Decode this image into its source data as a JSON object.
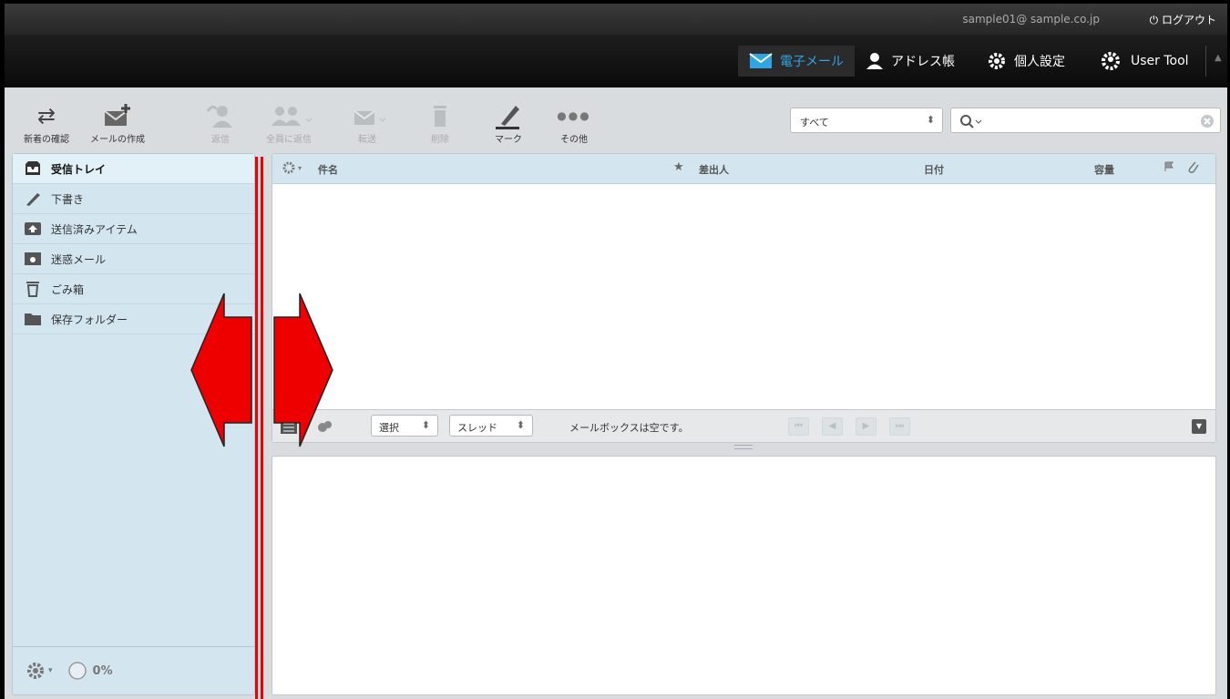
{
  "header": {
    "user_email": "sample01@ sample.co.jp",
    "logout_label": "ログアウト"
  },
  "nav": {
    "items": [
      {
        "label": "電子メール",
        "icon": "envelope-icon",
        "active": true
      },
      {
        "label": "アドレス帳",
        "icon": "person-icon"
      },
      {
        "label": "個人設定",
        "icon": "gear-icon"
      },
      {
        "label": "User Tool",
        "icon": "user-gear-icon"
      }
    ]
  },
  "toolbar": {
    "buttons": [
      {
        "label": "新着の確認",
        "icon": "refresh-arrows-icon",
        "enabled": true
      },
      {
        "label": "メールの作成",
        "icon": "compose-icon",
        "enabled": true
      },
      {
        "label": "返信",
        "icon": "reply-icon",
        "enabled": false
      },
      {
        "label": "全員に返信",
        "icon": "reply-all-icon",
        "enabled": false
      },
      {
        "label": "転送",
        "icon": "forward-icon",
        "enabled": false
      },
      {
        "label": "削除",
        "icon": "trash-icon",
        "enabled": false
      },
      {
        "label": "マーク",
        "icon": "pen-icon",
        "enabled": true
      },
      {
        "label": "その他",
        "icon": "more-dots-icon",
        "enabled": true
      }
    ],
    "filter_value": "すべて"
  },
  "sidebar": {
    "folders": [
      {
        "label": "受信トレイ",
        "icon": "inbox-icon",
        "active": true
      },
      {
        "label": "下書き",
        "icon": "pencil-icon"
      },
      {
        "label": "送信済みアイテム",
        "icon": "sent-icon"
      },
      {
        "label": "迷惑メール",
        "icon": "junk-icon"
      },
      {
        "label": "ごみ箱",
        "icon": "trash-icon"
      },
      {
        "label": "保存フォルダー",
        "icon": "folder-icon"
      }
    ],
    "quota": "0%"
  },
  "message_list": {
    "columns": {
      "subject": "件名",
      "from": "差出人",
      "date": "日付",
      "size": "容量"
    },
    "footer": {
      "select_label": "選択",
      "thread_label": "スレッド",
      "status": "メールボックスは空です。"
    }
  },
  "colors": {
    "accent": "#2fa4e7",
    "arrow": "#ee0000"
  }
}
